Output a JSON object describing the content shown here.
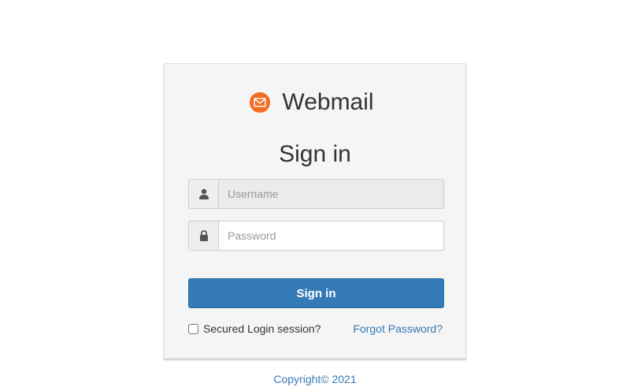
{
  "brand": {
    "name": "Webmail",
    "icon": "envelope-icon",
    "icon_color": "#f26b21"
  },
  "heading": "Sign in",
  "username": {
    "placeholder": "Username",
    "value": "",
    "icon": "user-icon"
  },
  "password": {
    "placeholder": "Password",
    "value": "",
    "icon": "lock-icon"
  },
  "signin_button": {
    "label": "Sign in",
    "color": "#337ab7"
  },
  "secured_login": {
    "label": "Secured Login session?",
    "checked": false
  },
  "forgot_password": "Forgot Password?",
  "footer": {
    "copyright": "Copyright© 2021"
  }
}
